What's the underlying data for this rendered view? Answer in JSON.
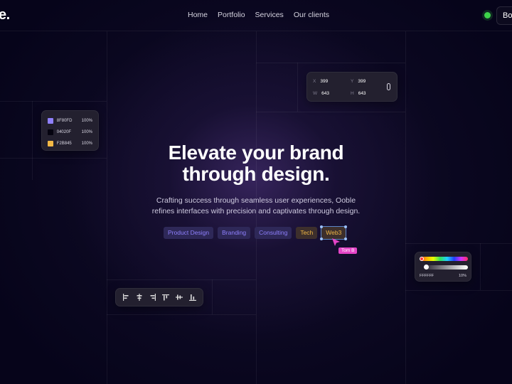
{
  "nav": {
    "logo": "e.",
    "links": [
      "Home",
      "Portfolio",
      "Services",
      "Our clients"
    ],
    "cta_label": "Bo",
    "status_color": "#3dd44a"
  },
  "swatch_panel": {
    "rows": [
      {
        "hex": "8F80FD",
        "opacity": "100%",
        "color": "#8f80fd"
      },
      {
        "hex": "04020F",
        "opacity": "100%",
        "color": "#04020f"
      },
      {
        "hex": "F2B845",
        "opacity": "100%",
        "color": "#f2b845"
      }
    ]
  },
  "transform_panel": {
    "x_label": "X",
    "x_value": "399",
    "y_label": "Y",
    "y_value": "399",
    "w_label": "W",
    "w_value": "643",
    "h_label": "H",
    "h_value": "643",
    "link_icon": "link-icon"
  },
  "hero": {
    "title_line1": "Elevate your brand",
    "title_line2": "through design.",
    "subtitle_line1": "Crafting success through seamless user experiences, Ooble",
    "subtitle_line2": "refines interfaces with precision and captivates through design."
  },
  "tags": [
    {
      "label": "Product Design",
      "style": "purple"
    },
    {
      "label": "Branding",
      "style": "purple"
    },
    {
      "label": "Consulting",
      "style": "purple"
    },
    {
      "label": "Tech",
      "style": "orange"
    },
    {
      "label": "Web3",
      "style": "orange",
      "selected": true
    }
  ],
  "cursor": {
    "label": "Tom B",
    "color": "#e545c7"
  },
  "color_picker": {
    "hex": "FFFFFF",
    "opacity": "10%",
    "hue_position": 0,
    "alpha_position": 0.1
  },
  "align_toolbar": {
    "icons": [
      "align-left-icon",
      "align-center-horizontal-icon",
      "align-right-icon",
      "align-top-icon",
      "align-center-vertical-icon",
      "align-bottom-icon"
    ]
  },
  "colors": {
    "background": "#06041a",
    "accent_purple": "#8f80fd",
    "accent_orange": "#f2b845",
    "cursor_pink": "#e545c7"
  }
}
